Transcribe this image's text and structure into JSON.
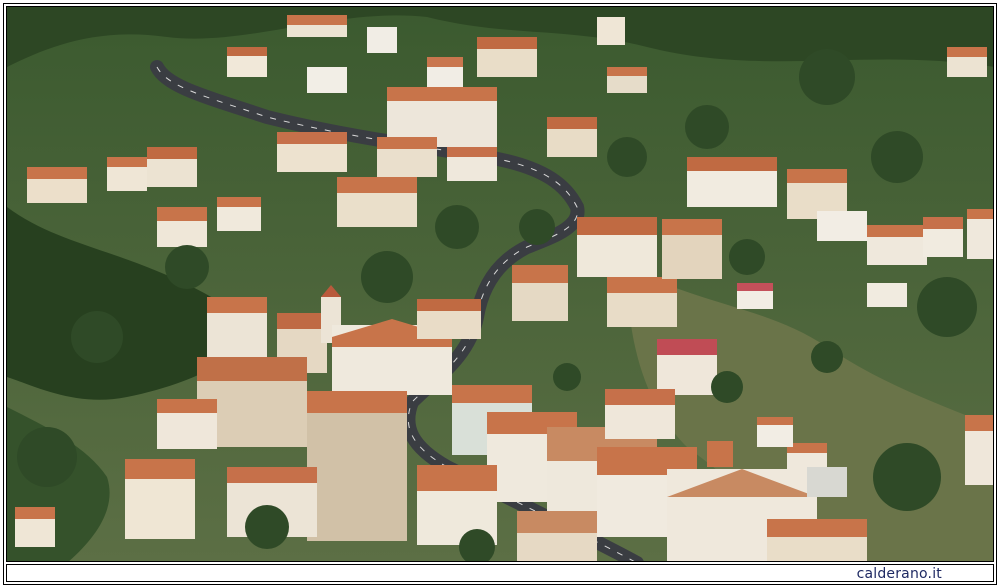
{
  "watermark": "calderano.it",
  "colors": {
    "frame": "#000000",
    "watermark_text": "#1f2a63",
    "vegetation_dark": "#2f4a27",
    "vegetation_mid": "#4f6b38",
    "road": "#3a3d42",
    "roof_terracotta": "#c8744a",
    "wall_cream": "#ece3d2"
  },
  "photo": {
    "subject": "aerial-view-hillside-village"
  }
}
